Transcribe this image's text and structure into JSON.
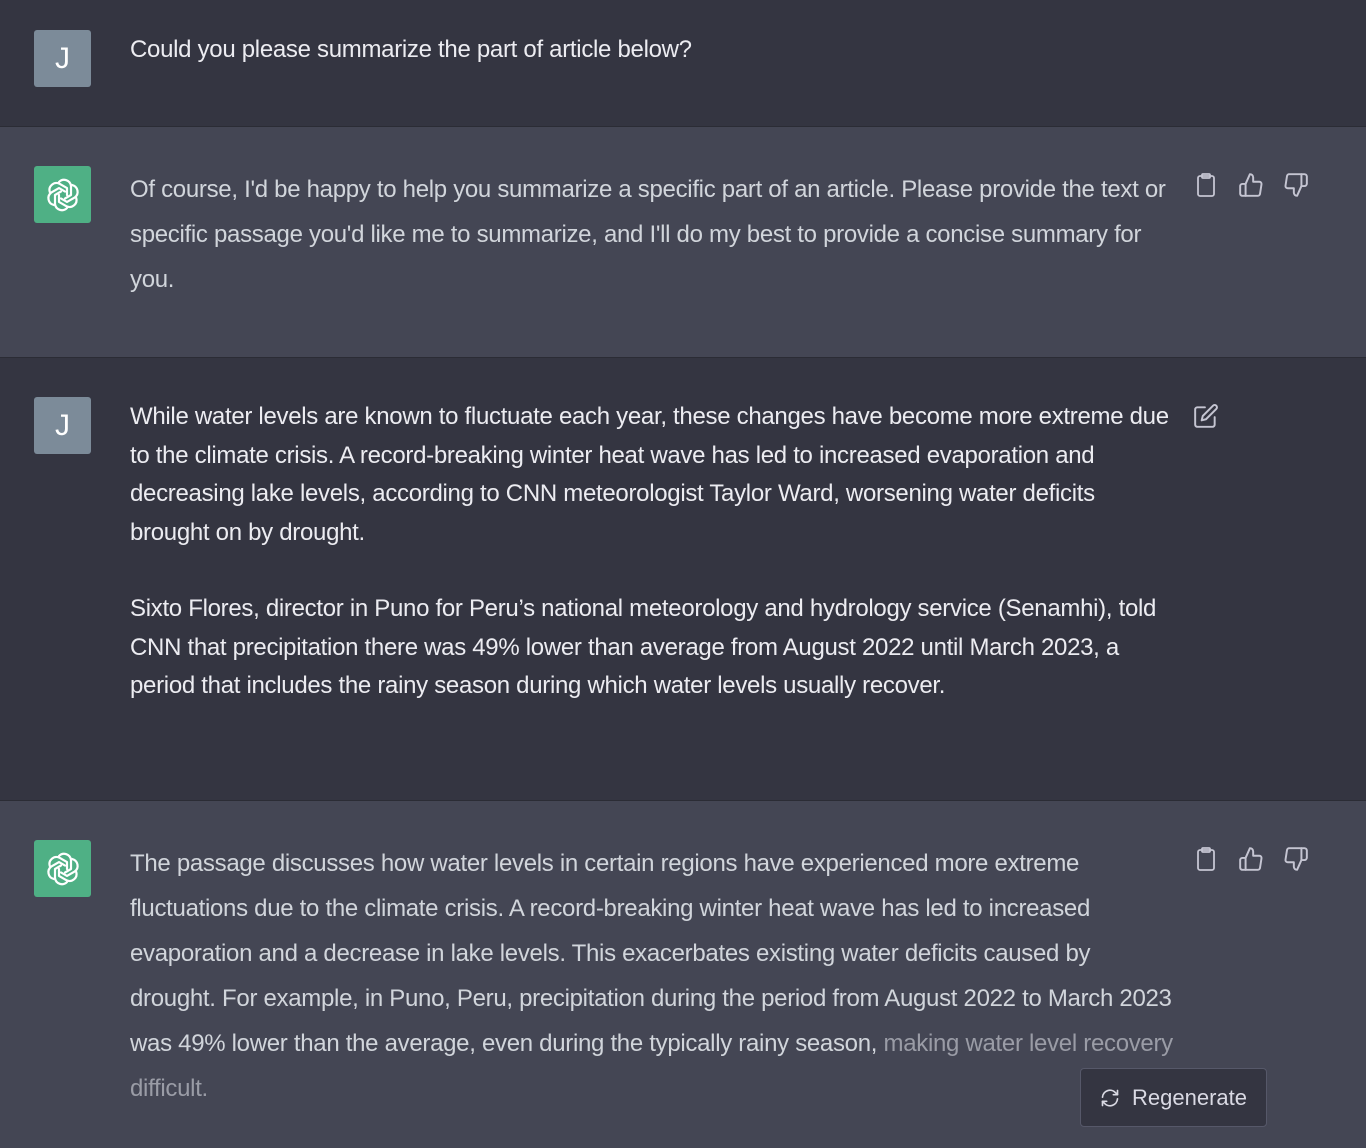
{
  "colors": {
    "user_bg": "#343541",
    "assistant_bg": "#444654",
    "bot_avatar": "#4fb085",
    "user_avatar": "#7c8b99"
  },
  "messages": [
    {
      "role": "user",
      "avatar_letter": "J",
      "paragraphs": [
        "Could you please summarize the part of article below?"
      ]
    },
    {
      "role": "assistant",
      "avatar_icon": "openai-logo-icon",
      "paragraphs": [
        "Of course, I'd be happy to help you summarize a specific part of an article. Please provide the text or specific passage you'd like me to summarize, and I'll do my best to provide a concise summary for you."
      ],
      "actions": [
        "clipboard-icon",
        "thumbs-up-icon",
        "thumbs-down-icon"
      ]
    },
    {
      "role": "user",
      "avatar_letter": "J",
      "paragraphs": [
        "While water levels are known to fluctuate each year, these changes have become more extreme due to the climate crisis. A record-breaking winter heat wave has led to increased evaporation and decreasing lake levels, according to CNN meteorologist Taylor Ward, worsening water deficits brought on by drought.",
        "Sixto Flores, director in Puno for Peru’s national meteorology and hydrology service (Senamhi), told CNN that precipitation there was 49% lower than average from August 2022 until March 2023, a period that includes the rainy season during which water levels usually recover."
      ],
      "actions": [
        "edit-icon"
      ]
    },
    {
      "role": "assistant",
      "avatar_icon": "openai-logo-icon",
      "paragraphs": [
        "The passage discusses how water levels in certain regions have experienced more extreme fluctuations due to the climate crisis. A record-breaking winter heat wave has led to increased evaporation and a decrease in lake levels. This exacerbates existing water deficits caused by drought. For example, in Puno, Peru, precipitation during the period from August 2022 to March 2023 was 49% lower than the average, even during the typically rainy season,"
      ],
      "fading_text": "making water level recovery difficult.",
      "actions": [
        "clipboard-icon",
        "thumbs-up-icon",
        "thumbs-down-icon"
      ]
    }
  ],
  "regenerate": {
    "label": "Regenerate",
    "icon": "refresh-icon"
  }
}
